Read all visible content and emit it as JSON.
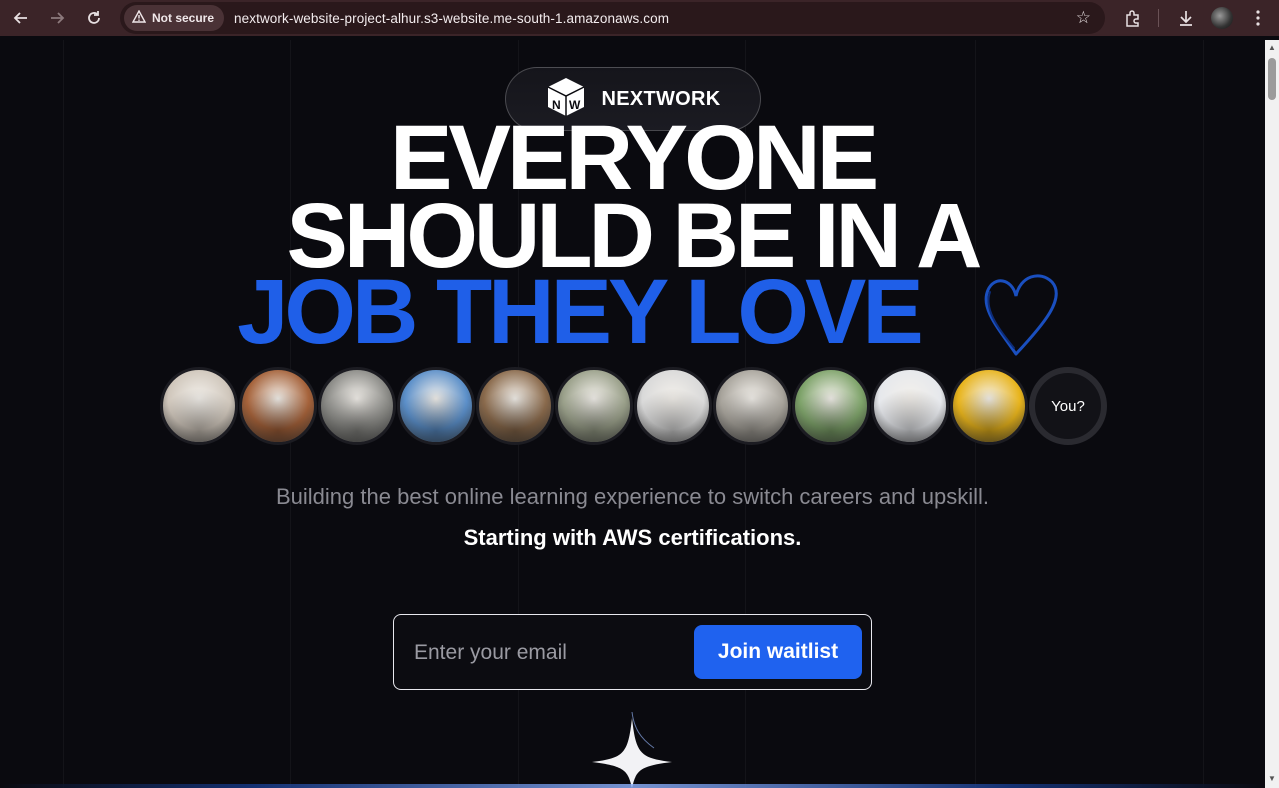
{
  "browser": {
    "security_label": "Not secure",
    "url": "nextwork-website-project-alhur.s3-website.me-south-1.amazonaws.com",
    "icons": [
      "back-icon",
      "forward-icon",
      "reload-icon",
      "warning-icon",
      "star-icon",
      "extensions-icon",
      "download-icon",
      "profile-icon",
      "menu-icon"
    ]
  },
  "brand": {
    "logo_letters": "NW",
    "name": "NEXTWORK"
  },
  "hero": {
    "line1": "EVERYONE",
    "line2": "SHOULD BE IN A",
    "line3": "JOB THEY LOVE",
    "accent_color": "#1f5fe8"
  },
  "avatars": {
    "items": [
      {
        "name": "fluffy-dog",
        "color": "#cfc6bb"
      },
      {
        "name": "squirrel",
        "color": "#a5623a"
      },
      {
        "name": "koala",
        "color": "#8a8a86"
      },
      {
        "name": "giraffe",
        "color": "#5b8fc9"
      },
      {
        "name": "cat",
        "color": "#8a6a4c"
      },
      {
        "name": "blanket-dog",
        "color": "#9aa08a"
      },
      {
        "name": "pug-glasses",
        "color": "#d9d9d9"
      },
      {
        "name": "seal",
        "color": "#a8a49c"
      },
      {
        "name": "alpaca",
        "color": "#7ea36a"
      },
      {
        "name": "pineapple",
        "color": "#e6e8ec"
      },
      {
        "name": "pug-yellow",
        "color": "#e8b41c"
      }
    ],
    "you_label": "You?"
  },
  "subtitle": {
    "line1": "Building the best online learning experience to switch careers and upskill.",
    "line2": "Starting with AWS certifications."
  },
  "form": {
    "email_placeholder": "Enter your email",
    "button_label": "Join waitlist"
  }
}
